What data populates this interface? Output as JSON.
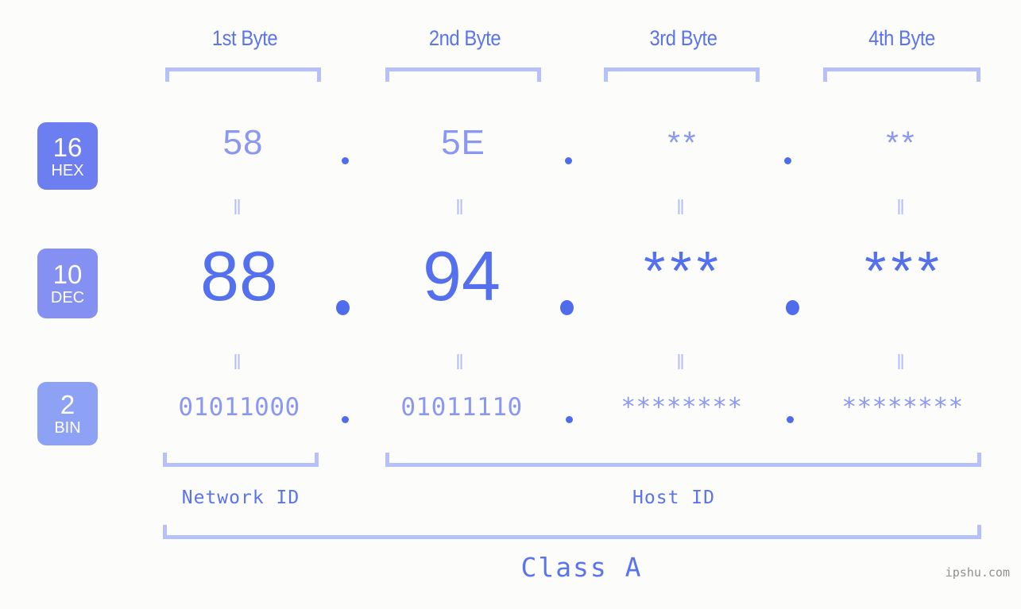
{
  "meta": {
    "watermark": "ipshu.com",
    "background_color": "#fcfdfa",
    "accent_strong": "#5570ee",
    "accent_mid": "#8b98f2",
    "accent_light": "#b6c1fb"
  },
  "byte_headers": [
    {
      "label": "1st Byte"
    },
    {
      "label": "2nd Byte"
    },
    {
      "label": "3rd Byte"
    },
    {
      "label": "4th Byte"
    }
  ],
  "rows": [
    {
      "badge_number": "16",
      "badge_name": "HEX",
      "badge_color": "#6d7ef0",
      "values": [
        "58",
        "5E",
        "**",
        "**"
      ],
      "masked": [
        false,
        false,
        true,
        true
      ],
      "separator": "."
    },
    {
      "badge_number": "10",
      "badge_name": "DEC",
      "badge_color": "#8491f2",
      "values": [
        "88",
        "94",
        "***",
        "***"
      ],
      "masked": [
        false,
        false,
        true,
        true
      ],
      "separator": "."
    },
    {
      "badge_number": "2",
      "badge_name": "BIN",
      "badge_color": "#8ea2f5",
      "values": [
        "01011000",
        "01011110",
        "********",
        "********"
      ],
      "masked": [
        false,
        false,
        true,
        true
      ],
      "separator": "."
    }
  ],
  "equality_marks": {
    "hex_to_dec": [
      "=",
      "=",
      "=",
      "="
    ],
    "dec_to_bin": [
      "=",
      "=",
      "=",
      "="
    ]
  },
  "sections": {
    "network_id": "Network ID",
    "host_id": "Host ID",
    "class": "Class A"
  }
}
